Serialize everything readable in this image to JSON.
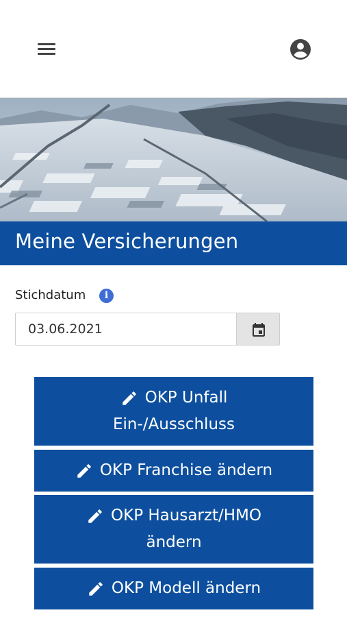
{
  "page": {
    "title": "Meine Versicherungen"
  },
  "date_field": {
    "label": "Stichdatum",
    "value": "03.06.2021"
  },
  "actions": [
    {
      "line1": "OKP Unfall",
      "line2": "Ein-/Ausschluss"
    },
    {
      "line1": "OKP Franchise ändern"
    },
    {
      "line1": "OKP Hausarzt/HMO",
      "line2": "ändern"
    },
    {
      "line1": "OKP Modell ändern"
    }
  ],
  "icons": {
    "menu": "hamburger-menu-icon",
    "account": "account-circle-icon",
    "info": "info-icon",
    "calendar": "calendar-icon",
    "edit": "pencil-icon"
  },
  "colors": {
    "brand_blue": "#0d4f9e",
    "info_blue": "#3f6dd6"
  }
}
